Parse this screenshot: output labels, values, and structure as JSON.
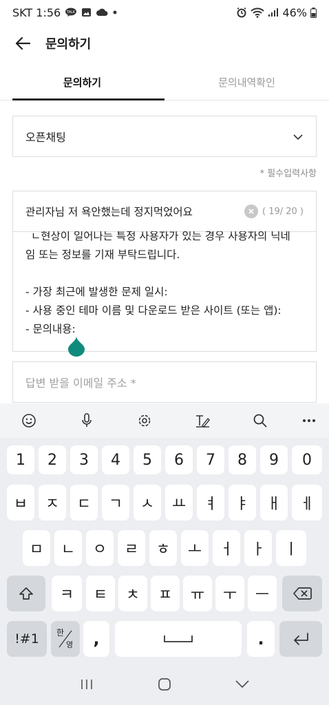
{
  "status_bar": {
    "carrier_time": "SKT 1:56",
    "battery": "46%",
    "icons": [
      "talk-icon",
      "gallery-icon",
      "cloud-icon",
      "dot-icon",
      "alarm-icon",
      "wifi-icon",
      "signal-icon",
      "battery-icon"
    ]
  },
  "app_bar": {
    "title": "문의하기",
    "back_icon": "back-arrow-icon"
  },
  "tabs": [
    {
      "label": "문의하기",
      "active": true
    },
    {
      "label": "문의내역확인",
      "active": false
    }
  ],
  "category_select": {
    "value": "오픈채팅"
  },
  "required_note": "* 필수입력사항",
  "title_field": {
    "value": "관리자님 저 욕안했는데 정지먹었어요",
    "counter": "( 19/ 20 )"
  },
  "body_field": {
    "lines": [
      "ㄴ현상이 일어나는 특정 사용자가 있는 경우 사용자의 닉네",
      "임 또는 정보를 기재 부탁드립니다.",
      "",
      "- 가장 최근에 발생한 문제 일시:",
      "- 사용 중인 테마 이름 및 다운로드 받은 사이트 (또는 앱):",
      "- 문의내용:"
    ]
  },
  "email_field": {
    "placeholder": "답변 받을 이메일 주소 *"
  },
  "keyboard": {
    "toolbar": [
      "emoji-icon",
      "mic-icon",
      "settings-icon",
      "handwriting-icon",
      "search-icon",
      "more-icon"
    ],
    "number_row": [
      "1",
      "2",
      "3",
      "4",
      "5",
      "6",
      "7",
      "8",
      "9",
      "0"
    ],
    "row1": [
      "ㅂ",
      "ㅈ",
      "ㄷ",
      "ㄱ",
      "ㅅ",
      "ㅛ",
      "ㅕ",
      "ㅑ",
      "ㅐ",
      "ㅔ"
    ],
    "row2": [
      "ㅁ",
      "ㄴ",
      "ㅇ",
      "ㄹ",
      "ㅎ",
      "ㅗ",
      "ㅓ",
      "ㅏ",
      "ㅣ"
    ],
    "row3": [
      "ㅋ",
      "ㅌ",
      "ㅊ",
      "ㅍ",
      "ㅠ",
      "ㅜ",
      "ㅡ"
    ],
    "symbols_label": "!#1",
    "lang_top": "한",
    "lang_bottom": "영",
    "comma": ",",
    "period": "."
  },
  "colors": {
    "accent": "#0f8b7d",
    "keyboard_bg": "#eceef1",
    "key_fn": "#d4d7dc"
  }
}
